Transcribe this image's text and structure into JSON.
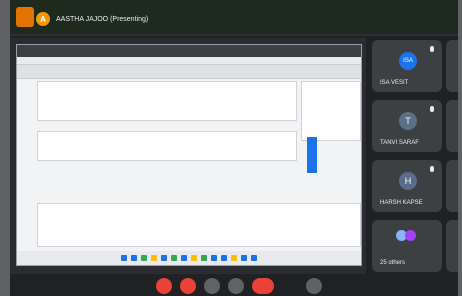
{
  "meeting": {
    "presenter": {
      "initial": "A",
      "label": "AASTHA JAJOO (Presenting)"
    },
    "participants": [
      {
        "name": "ISA VESIT",
        "initial": "ISA"
      },
      {
        "name": "TANVI SARAF",
        "initial": "T"
      },
      {
        "name": "HARSH KAPSE",
        "initial": "H"
      },
      {
        "name": "25 others"
      }
    ]
  },
  "colors": {
    "accent_orange": "#f29900",
    "tile_bg": "#3c4043",
    "end_call_red": "#ea4335",
    "avatar_isa": "#1a73e8",
    "avatar_tanvi": "#5b6f86",
    "avatar_harsh": "#5c6b8a",
    "others_a": "#8ab4f8",
    "others_b": "#a142f4"
  }
}
